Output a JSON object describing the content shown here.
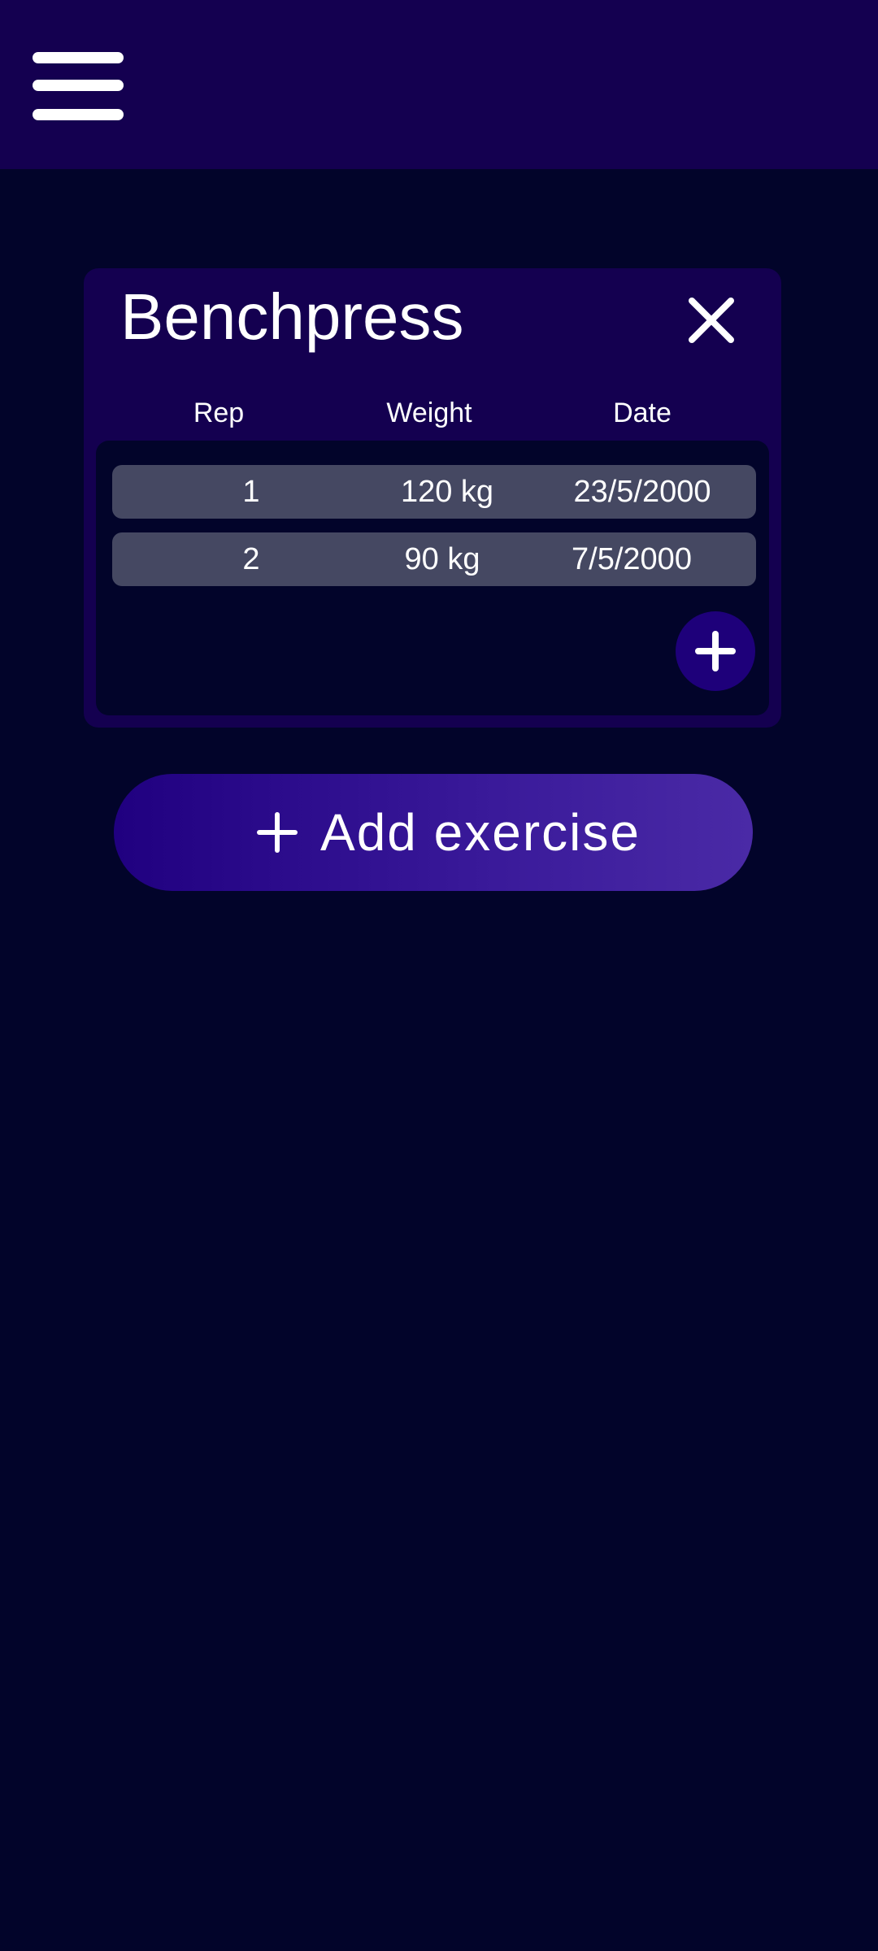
{
  "app_bar": {
    "menu_icon": "hamburger-menu-icon"
  },
  "exercise_card": {
    "title": "Benchpress",
    "close_icon": "close-icon",
    "columns": [
      "Rep",
      "Weight",
      "Date"
    ],
    "sets": [
      {
        "rep": "1",
        "weight": "120 kg",
        "date": "23/5/2000"
      },
      {
        "rep": "2",
        "weight": "90 kg",
        "date": "7/5/2000"
      }
    ],
    "add_set_icon": "plus-icon"
  },
  "add_exercise": {
    "icon": "plus-icon",
    "label": "Add exercise"
  },
  "colors": {
    "background": "#02042a",
    "app_bar": "#140050",
    "card": "#140050",
    "row": "#454862",
    "accent": "#1e007a"
  }
}
